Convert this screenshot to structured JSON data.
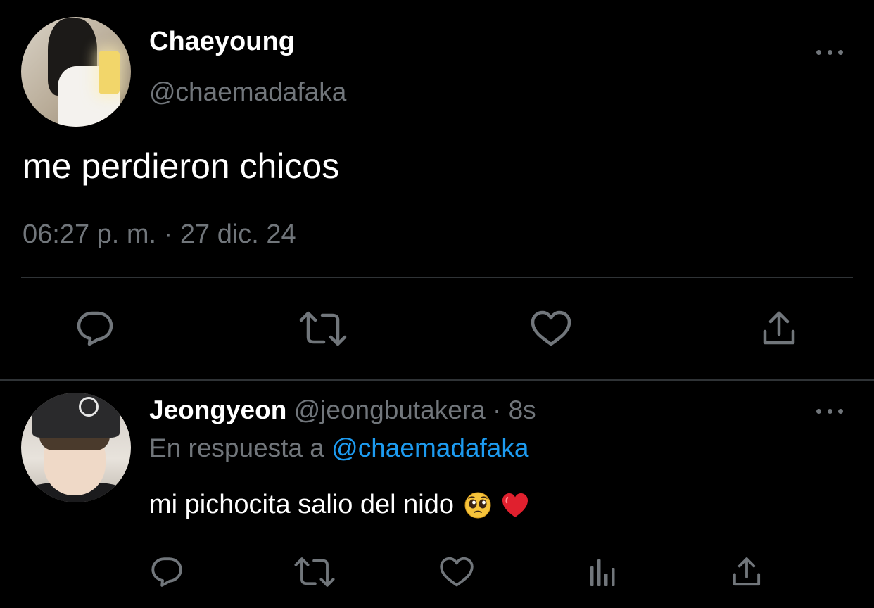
{
  "main_tweet": {
    "author_name": "Chaeyoung",
    "author_handle": "@chaemadafaka",
    "text": "me perdieron chicos",
    "timestamp": "06:27 p. m. · 27 dic. 24",
    "more_icon": "more-horizontal-icon",
    "actions": [
      {
        "name": "reply",
        "icon": "reply-bubble-icon"
      },
      {
        "name": "retweet",
        "icon": "retweet-icon"
      },
      {
        "name": "like",
        "icon": "heart-icon"
      },
      {
        "name": "share",
        "icon": "share-upload-icon"
      }
    ]
  },
  "reply_tweet": {
    "author_name": "Jeongyeon",
    "author_handle": "@jeongbutakera",
    "separator": " · ",
    "time_ago": "8s",
    "context_prefix": "En respuesta a ",
    "context_mention": "@chaemadafaka",
    "text": "mi pichocita salio del nido",
    "emojis": [
      "pleading-face",
      "red-heart"
    ],
    "actions": [
      {
        "name": "reply",
        "icon": "reply-bubble-icon"
      },
      {
        "name": "retweet",
        "icon": "retweet-icon"
      },
      {
        "name": "like",
        "icon": "heart-icon"
      },
      {
        "name": "analytics",
        "icon": "analytics-bars-icon"
      },
      {
        "name": "share",
        "icon": "share-upload-icon"
      }
    ]
  },
  "colors": {
    "background": "#000000",
    "primary_text": "#FFFFFF",
    "secondary_text": "#71767B",
    "mention": "#1D9BF0",
    "divider": "#2F3336",
    "icon": "#71767B"
  }
}
